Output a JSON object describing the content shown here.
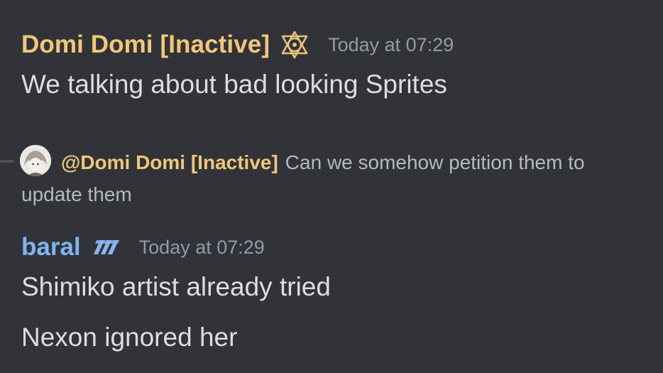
{
  "message1": {
    "author": "Domi Domi [Inactive]",
    "role_icon": "triangle-knot-icon",
    "timestamp": "Today at 07:29",
    "text": "We talking about bad looking Sprites"
  },
  "reply": {
    "avatar": "user-avatar",
    "mention": "@Domi Domi [Inactive]",
    "content": "Can we somehow petition them to update them"
  },
  "message2": {
    "author": "baral",
    "tag_icon": "clan-tag-icon",
    "timestamp": "Today at 07:29",
    "lines": [
      "Shimiko artist already tried",
      "Nexon ignored her"
    ]
  },
  "colors": {
    "background": "#313338",
    "author_gold": "#f0c77a",
    "author_blue": "#7fb5f0",
    "text": "#dbdee1",
    "muted": "#949ba4"
  }
}
